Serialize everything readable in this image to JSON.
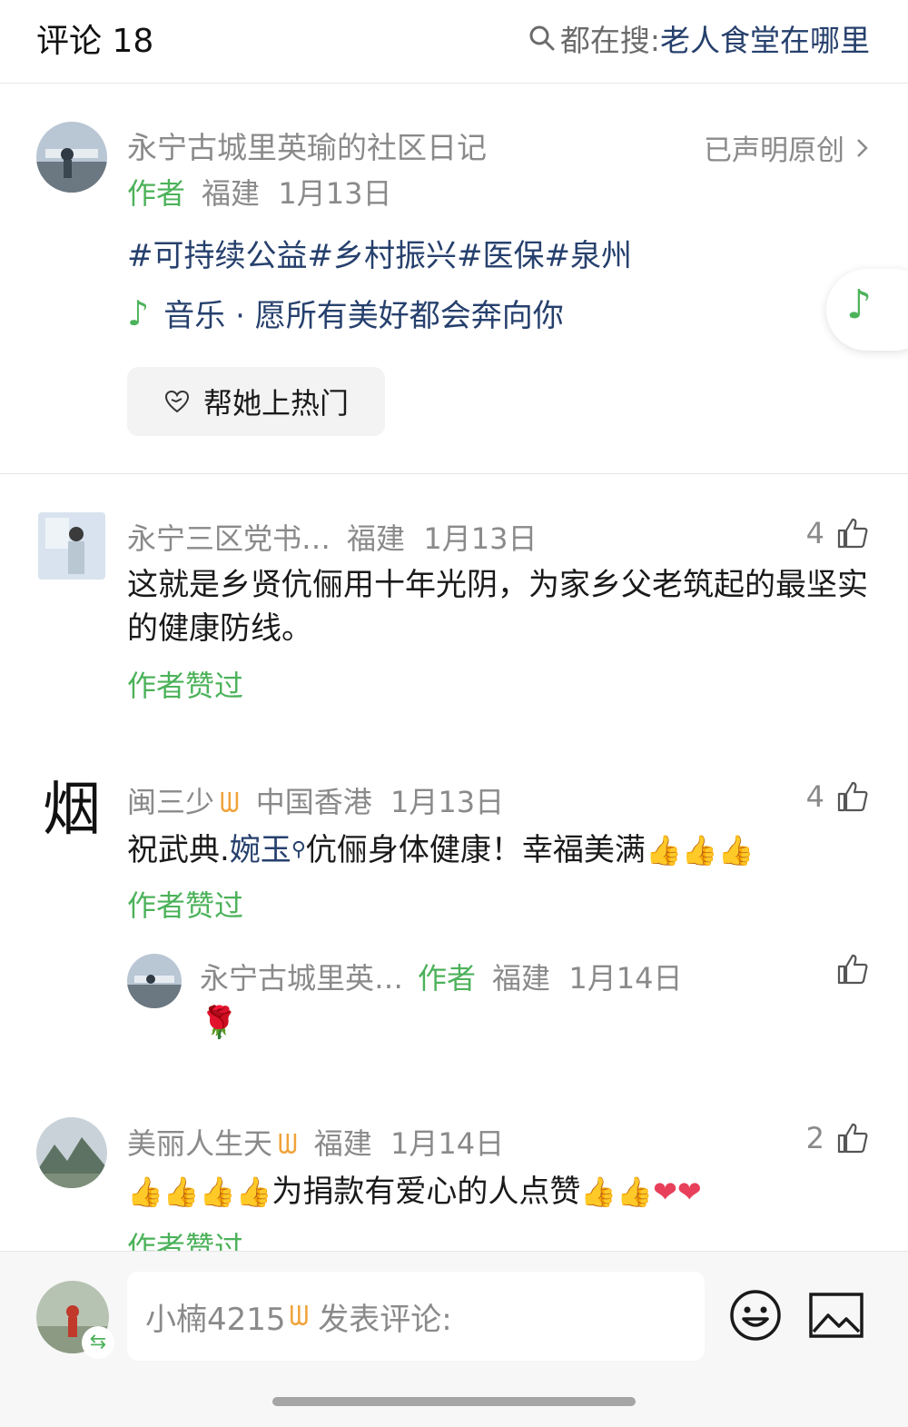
{
  "header": {
    "title": "评论 18",
    "search_prefix": "都在搜: ",
    "search_query": "老人食堂在哪里"
  },
  "post": {
    "author_name": "永宁古城里英瑜的社区日记",
    "original_label": "已声明原创",
    "author_tag": "作者",
    "location": "福建",
    "date": "1月13日",
    "hashtags": "#可持续公益#乡村振兴#医保#泉州",
    "music_note": "♪",
    "music_label": "音乐 · 愿所有美好都会奔向你",
    "boost_label": "帮她上热门"
  },
  "comments": [
    {
      "user": "永宁三区党书…",
      "location": "福建",
      "date": "1月13日",
      "likes": "4",
      "text": "这就是乡贤伉俪用十年光阴，为家乡父老筑起的最坚实的健康防线。",
      "liked_label": "作者赞过"
    },
    {
      "user": "闽三少",
      "location": "中国香港",
      "date": "1月13日",
      "likes": "4",
      "text_before": "祝武典.",
      "text_link": "婉玉",
      "text_after": "伉俪身体健康！幸福美满",
      "liked_label": "作者赞过",
      "avatar_char": "烟"
    },
    {
      "user": "永宁古城里英…",
      "author_tag": "作者",
      "location": "福建",
      "date": "1月14日",
      "emoji": "🌹"
    },
    {
      "user": "美丽人生天",
      "location": "福建",
      "date": "1月14日",
      "likes": "2",
      "text": "为捐款有爱心的人点赞",
      "liked_label": "作者赞过"
    }
  ],
  "bottom": {
    "user": "小楠4215",
    "placeholder": "发表评论:"
  },
  "icons": {
    "vip": "vip-badge-icon",
    "like": "thumbs-up-icon",
    "search": "search-icon",
    "music": "music-note-icon",
    "emoji": "emoji-icon",
    "image": "image-icon"
  },
  "colors": {
    "green": "#4cb25a",
    "link": "#26406d",
    "vip": "#f0a33b",
    "gray": "#8a8a8a"
  }
}
